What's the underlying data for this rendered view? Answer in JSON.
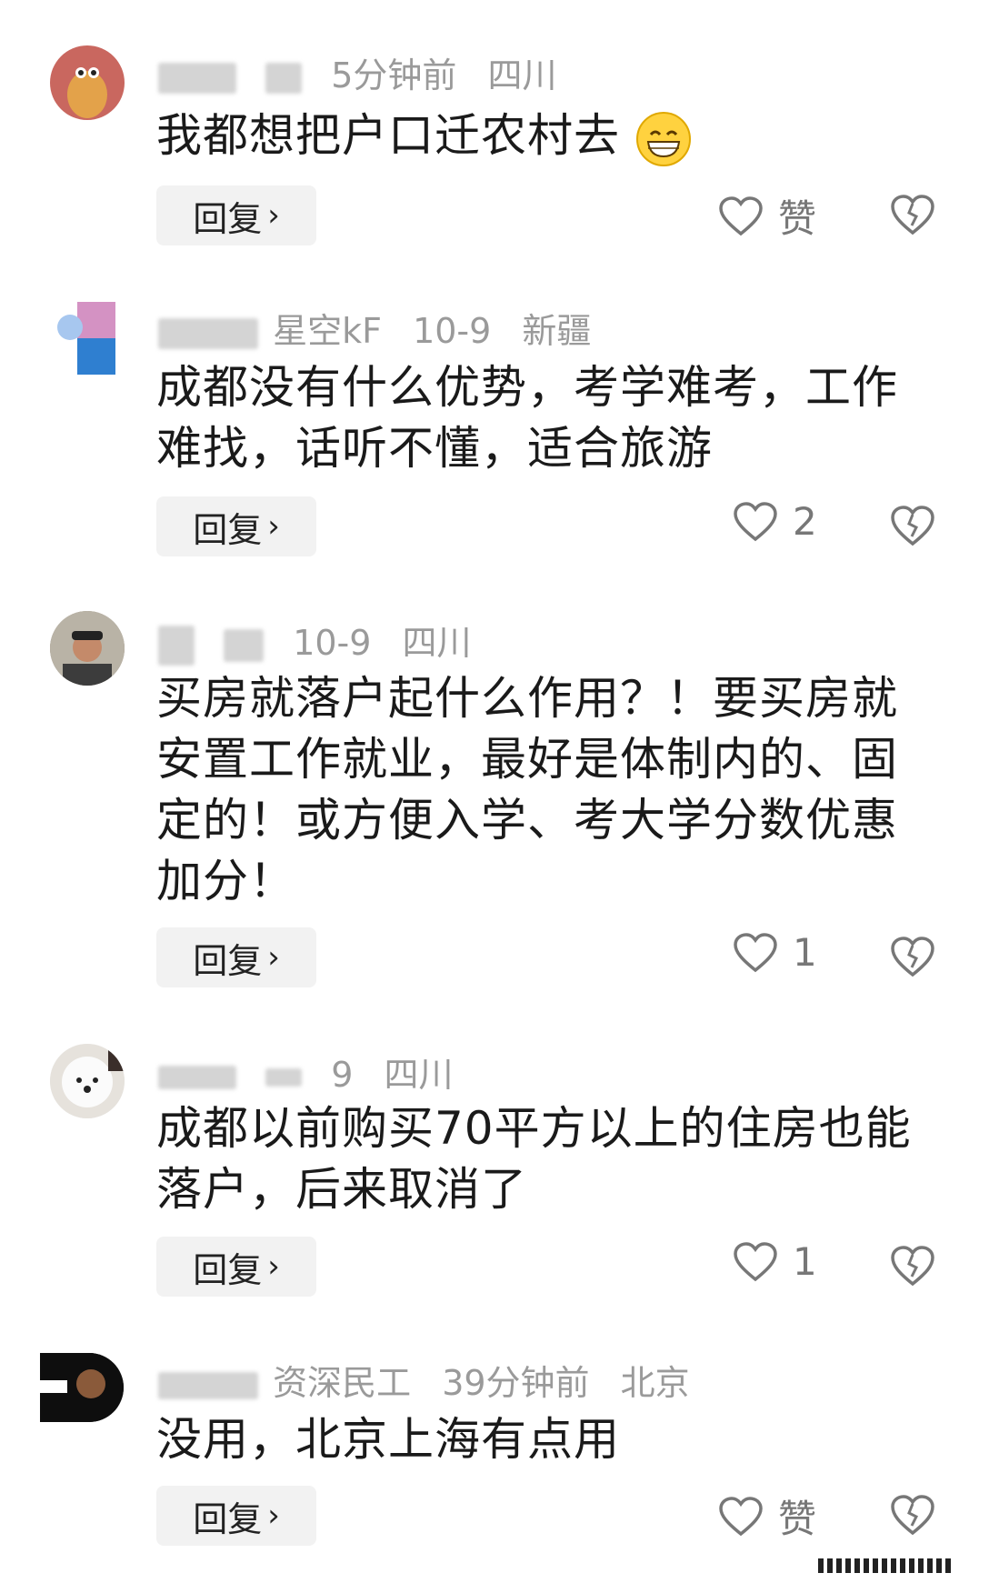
{
  "comments": [
    {
      "time": "5分钟前",
      "location": "四川",
      "name_visible": "",
      "text": "我都想把户口迁农村去",
      "reply": "回复",
      "like": "赞"
    },
    {
      "time": "10-9",
      "location": "新疆",
      "name_visible": "星空kF",
      "text": "成都没有什么优势，考学难考，工作难找，话听不懂，适合旅游",
      "reply": "回复",
      "like": "2"
    },
    {
      "time": "10-9",
      "location": "四川",
      "name_visible": "",
      "text": "买房就落户起什么作用？！要买房就安置工作就业，最好是体制内的、固定的！或方便入学、考大学分数优惠加分！",
      "reply": "回复",
      "like": "1"
    },
    {
      "time": "9",
      "location": "四川",
      "name_visible": "",
      "text": "成都以前购买70平方以上的住房也能落户，后来取消了",
      "reply": "回复",
      "like": "1"
    },
    {
      "time": "39分钟前",
      "location": "北京",
      "name_visible": "资深民工",
      "text": "没用，北京上海有点用",
      "reply": "回复",
      "like": "赞"
    }
  ],
  "colors": {
    "meta": "#9a9a9a",
    "reply_bg": "#f2f2f2",
    "icon": "#777777"
  },
  "icons": {
    "like": "heart-outline-icon",
    "dislike": "broken-heart-icon",
    "reply_arrow": "chevron-right-icon",
    "emoji": "grinning-face-icon"
  }
}
